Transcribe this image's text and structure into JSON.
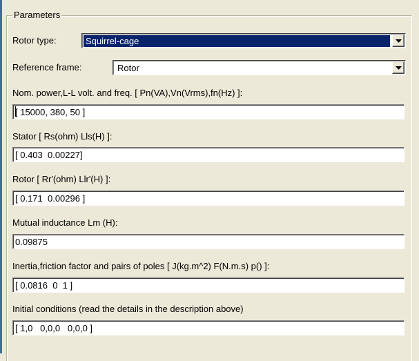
{
  "group": {
    "title": "Parameters"
  },
  "rotor_type": {
    "label": "Rotor type:",
    "value": "Squirrel-cage"
  },
  "reference_frame": {
    "label": "Reference frame:",
    "value": "Rotor"
  },
  "nominal": {
    "label": "Nom. power,L-L volt. and freq. [ Pn(VA),Vn(Vrms),fn(Hz) ]:",
    "value": "[ 15000, 380, 50 ]"
  },
  "stator": {
    "label": "Stator [ Rs(ohm)  Lls(H) ]:",
    "value": "[ 0.403  0.00227]"
  },
  "rotor": {
    "label": "Rotor [ Rr'(ohm)  Llr'(H) ]:",
    "value": "[ 0.171  0.00296 ]"
  },
  "mutual": {
    "label": "Mutual inductance Lm (H):",
    "value": "0.09875"
  },
  "inertia": {
    "label": "Inertia,friction factor and pairs of poles [ J(kg.m^2)  F(N.m.s)  p() ]:",
    "value": "[ 0.0816  0  1 ]"
  },
  "initial": {
    "label": "Initial conditions  (read the details in the description above)",
    "value": "[ 1,0   0,0,0   0,0,0 ]"
  },
  "icons": {
    "dropdown": "chevron-down-icon"
  }
}
